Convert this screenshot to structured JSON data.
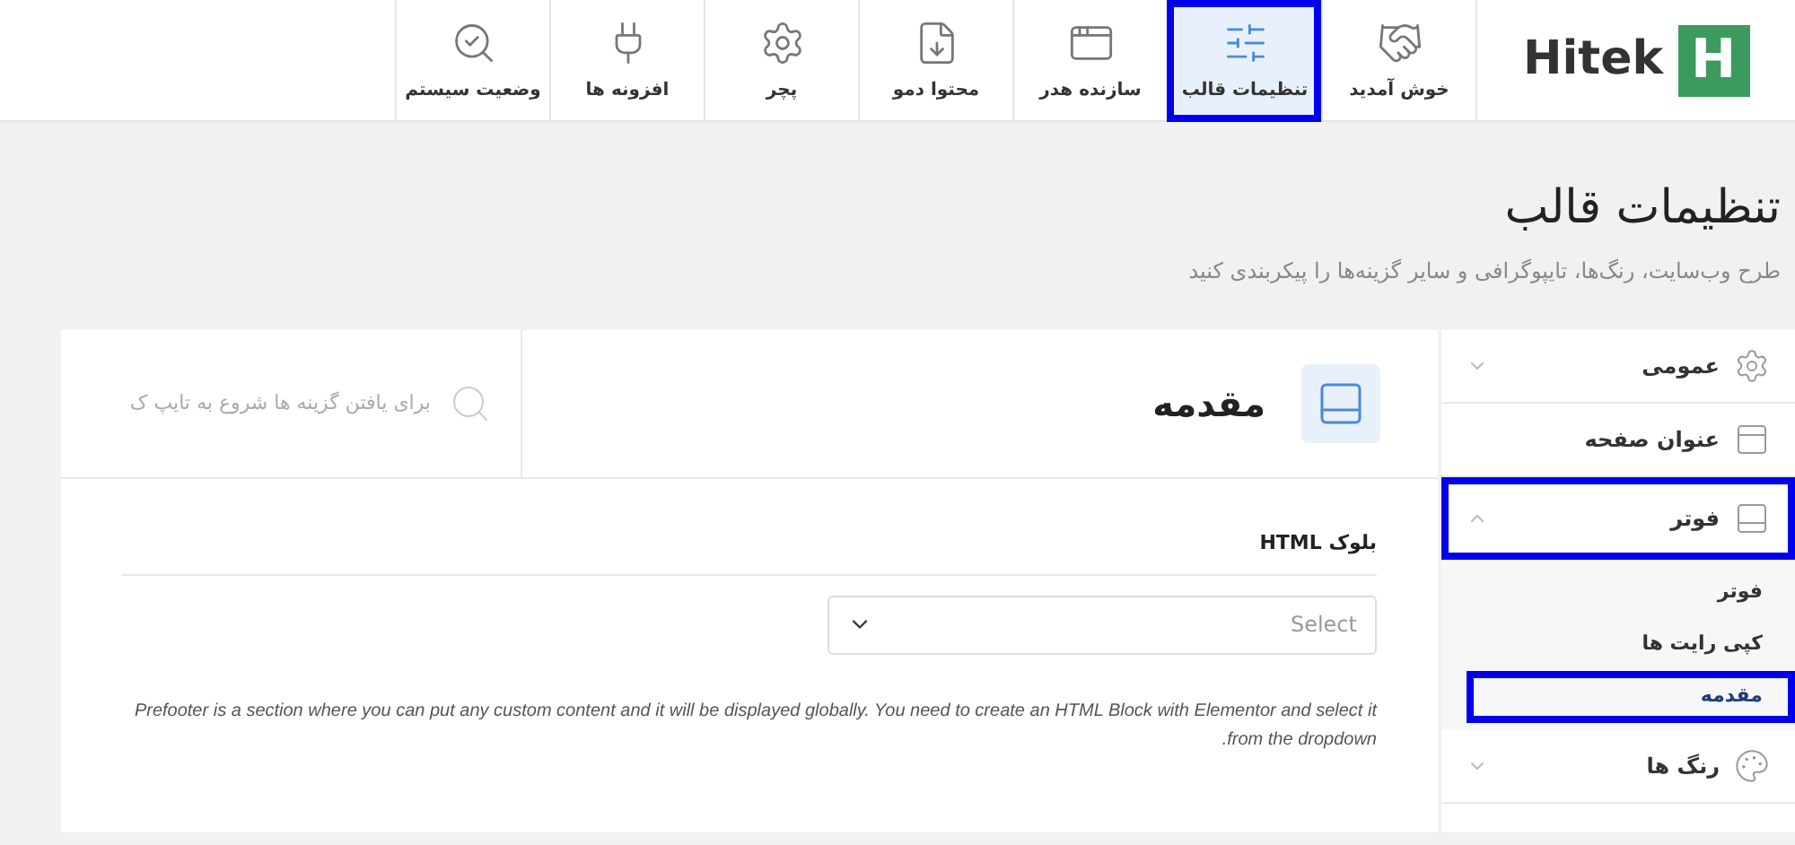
{
  "logo": {
    "letter": "H",
    "text": "Hitek"
  },
  "nav": [
    {
      "label": "خوش آمدید",
      "selected": false
    },
    {
      "label": "تنظیمات قالب",
      "selected": true
    },
    {
      "label": "سازنده هدر",
      "selected": false
    },
    {
      "label": "محتوا دمو",
      "selected": false
    },
    {
      "label": "پچر",
      "selected": false
    },
    {
      "label": "افزونه ها",
      "selected": false
    },
    {
      "label": "وضعیت سیستم",
      "selected": false
    }
  ],
  "page": {
    "title": "تنظیمات قالب",
    "subtitle": "طرح وب‌سایت، رنگ‌ها، تایپوگرافی و سایر گزینه‌ها را پیکربندی کنید"
  },
  "sidebar": [
    {
      "label": "عمومی",
      "kind": "group",
      "expanded": false,
      "selected": false
    },
    {
      "label": "عنوان صفحه",
      "kind": "link",
      "selected": false
    },
    {
      "label": "فوتر",
      "kind": "group",
      "expanded": true,
      "selected": true,
      "children": [
        {
          "label": "فوتر",
          "selected": false
        },
        {
          "label": "کپی رایت ها",
          "selected": false
        },
        {
          "label": "مقدمه",
          "selected": true
        }
      ]
    },
    {
      "label": "رنگ ها",
      "kind": "group",
      "expanded": false,
      "selected": false
    }
  ],
  "section": {
    "title": "مقدمه",
    "search": {
      "placeholder": "برای یافتن گزینه ها شروع به تایپ ک"
    },
    "field": {
      "label": "بلوک HTML",
      "select": {
        "placeholder": "Select"
      },
      "description": "Prefooter is a section where you can put any custom content and it will be displayed globally. You need to create an HTML Block with Elementor and select it from the dropdown."
    }
  }
}
